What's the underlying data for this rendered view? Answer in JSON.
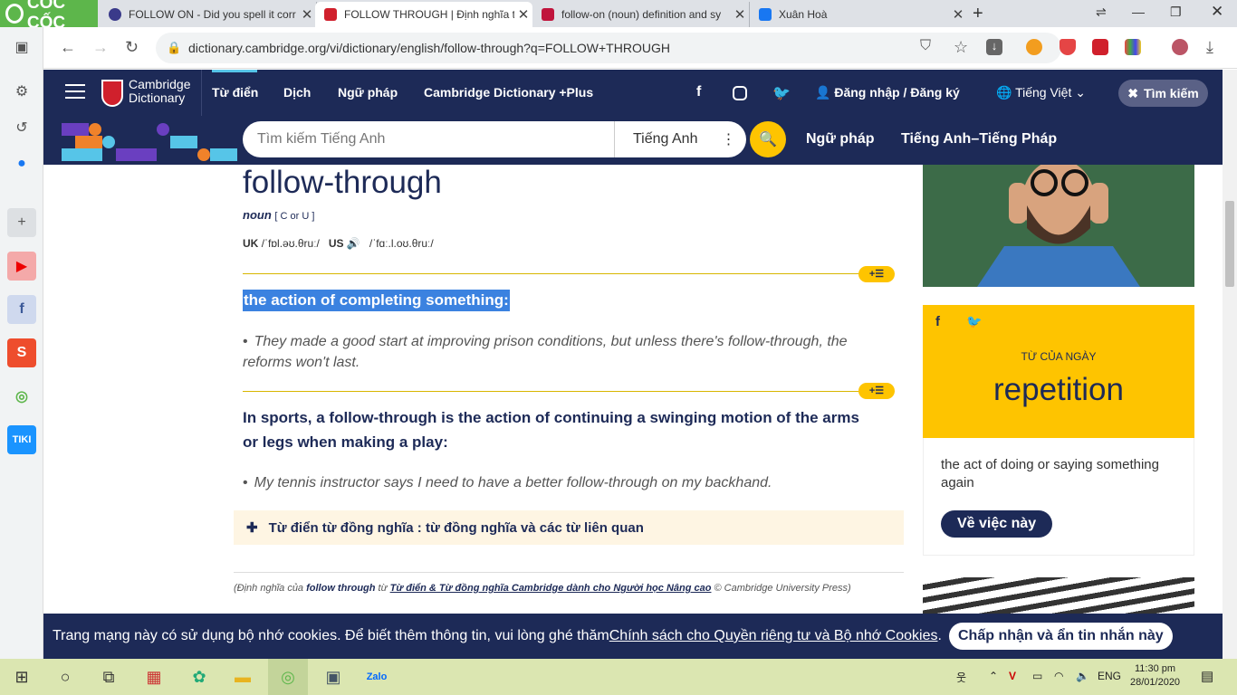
{
  "browser": {
    "brand": "CỐC CỐC",
    "tabs": [
      {
        "title": "FOLLOW ON - Did you spell it corr",
        "fav": "#3a3a8a"
      },
      {
        "title": "FOLLOW THROUGH | Định nghĩa t",
        "fav": "#d0202c"
      },
      {
        "title": "follow-on (noun) definition and sy",
        "fav": "#c0143c"
      },
      {
        "title": "Xuân Hoà",
        "fav": "#1877f2"
      }
    ],
    "url": "dictionary.cambridge.org/vi/dictionary/english/follow-through?q=FOLLOW+THROUGH"
  },
  "site": {
    "brand_line1": "Cambridge",
    "brand_line2": "Dictionary",
    "nav": [
      "Từ điển",
      "Dịch",
      "Ngữ pháp",
      "Cambridge Dictionary +Plus"
    ],
    "login": "Đăng nhập / Đăng ký",
    "language": "Tiếng Việt",
    "search_toggle": "Tìm kiếm",
    "search_placeholder": "Tìm kiếm Tiếng Anh",
    "search_lang": "Tiếng Anh",
    "quick_links": [
      "Ngữ pháp",
      "Tiếng Anh–Tiếng Pháp"
    ]
  },
  "entry": {
    "headword": "follow-through",
    "pos": "noun",
    "grammar": "[ C or U ]",
    "uk_label": "UK",
    "uk_ipa": "/ˈfɒl.əʊ.θruː/",
    "us_label": "US",
    "us_ipa": "/ˈfɑː.l.oʊ.θruː/",
    "plus_label": "+☰",
    "def1": "the action of completing something:",
    "ex1": "They made a good start at improving prison conditions, but unless there's follow-through, the reforms won't last.",
    "def2": "In sports, a follow-through is the action of continuing a swinging motion of the arms or legs when making a play:",
    "ex2": "My tennis instructor says I need to have a better follow-through on my backhand.",
    "thesaurus": "Từ điển từ đồng nghĩa : từ đồng nghĩa và các từ liên quan",
    "credit_pre": "(Định nghĩa của ",
    "credit_word": "follow through",
    "credit_mid": " từ ",
    "credit_link": "Từ điển & Từ đồng nghĩa Cambridge dành cho Người học Nâng cao",
    "credit_post": " © Cambridge University Press)"
  },
  "wotd": {
    "label": "TỪ CỦA NGÀY",
    "word": "repetition",
    "definition": "the act of doing or saying something again",
    "button": "Về việc này"
  },
  "cookie": {
    "text": "Trang mạng này có sử dụng bộ nhớ cookies. Để biết thêm thông tin, vui lòng ghé thăm ",
    "link": "Chính sách cho Quyền riêng tư và Bộ nhớ Cookies",
    "accept": "Chấp nhận và ẩn tin nhắn này"
  },
  "taskbar": {
    "lang": "ENG",
    "time": "11:30 pm",
    "date": "28/01/2020"
  }
}
